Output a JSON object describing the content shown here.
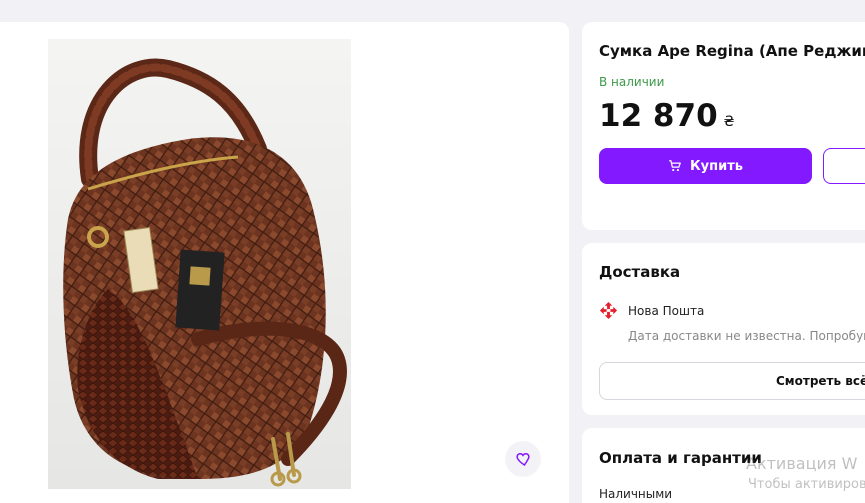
{
  "product": {
    "title": "Сумка Ape Regina (Апе Реджина)",
    "stock_status": "В наличии",
    "price": "12 870",
    "currency": "₴",
    "buy_label": "Купить",
    "image_alt": "Коричневая плетёная кожаная сумка"
  },
  "delivery": {
    "heading": "Доставка",
    "carrier": "Нова Пошта",
    "note": "Дата доставки не известна. Попробуйте в",
    "see_all": "Смотреть всё"
  },
  "payment": {
    "heading": "Оплата и гарантии",
    "method": "Наличными"
  },
  "watermark": {
    "title": "Активация W",
    "subtitle": "Чтобы активиров"
  },
  "colors": {
    "accent": "#8219ff",
    "in_stock": "#3c9a4a",
    "nova_poshta": "#e5202d"
  },
  "icons": {
    "favorite": "heart-icon",
    "cart": "cart-icon",
    "carrier": "nova-poshta-logo"
  }
}
